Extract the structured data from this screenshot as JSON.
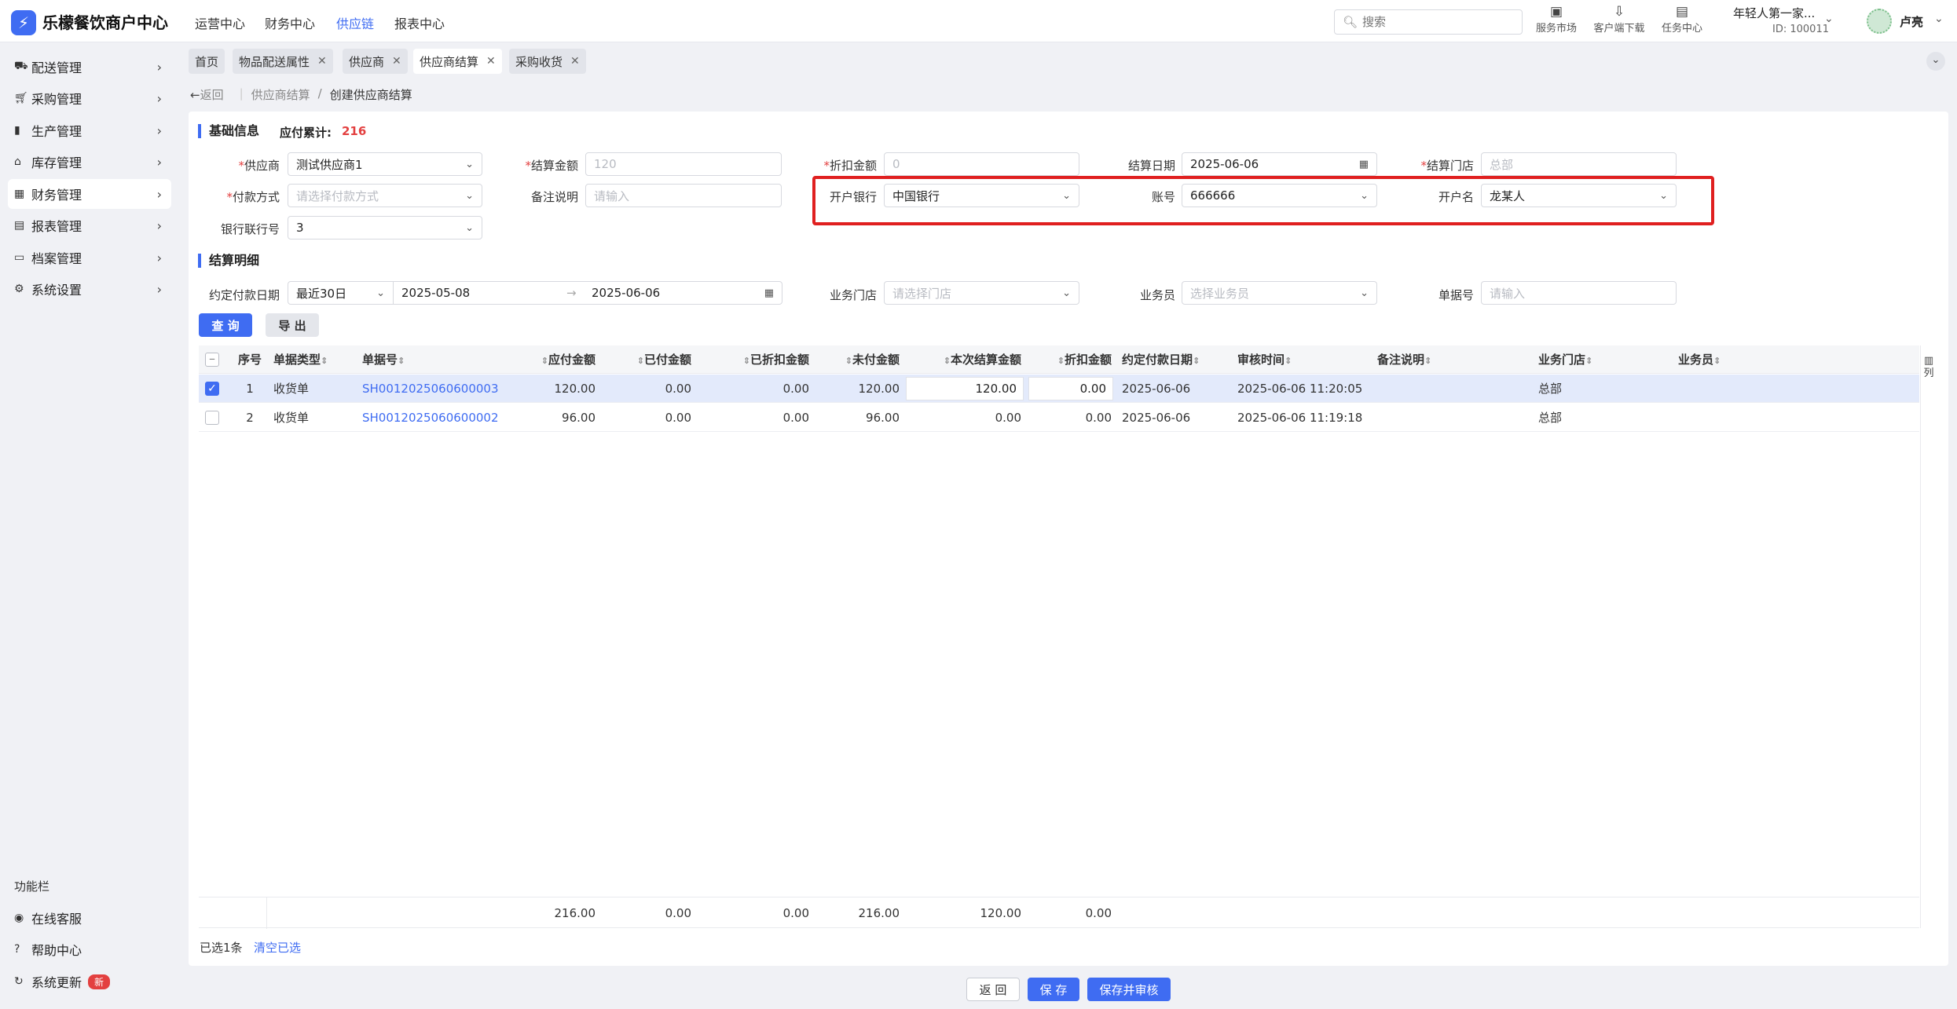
{
  "header": {
    "brand": "乐檬餐饮商户中心",
    "nav": [
      "运营中心",
      "财务中心",
      "供应链",
      "报表中心"
    ],
    "active_nav": "供应链",
    "search_placeholder": "搜索",
    "tools": [
      {
        "icon": "store-icon",
        "label": "服务市场"
      },
      {
        "icon": "download-icon",
        "label": "客户端下载"
      },
      {
        "icon": "task-icon",
        "label": "任务中心"
      }
    ],
    "org_name": "年轻人第一家...",
    "org_id": "ID: 100011",
    "user_name": "卢亮"
  },
  "sidebar": {
    "items": [
      {
        "icon": "truck-icon",
        "label": "配送管理"
      },
      {
        "icon": "cart-icon",
        "label": "采购管理"
      },
      {
        "icon": "chart-icon",
        "label": "生产管理"
      },
      {
        "icon": "warehouse-icon",
        "label": "库存管理"
      },
      {
        "icon": "ledger-icon",
        "label": "财务管理"
      },
      {
        "icon": "report-icon",
        "label": "报表管理"
      },
      {
        "icon": "archive-icon",
        "label": "档案管理"
      },
      {
        "icon": "gear-icon",
        "label": "系统设置"
      }
    ],
    "active_item": "财务管理",
    "footer_title": "功能栏",
    "footer_items": [
      {
        "icon": "headset-icon",
        "label": "在线客服"
      },
      {
        "icon": "help-icon",
        "label": "帮助中心"
      },
      {
        "icon": "refresh-icon",
        "label": "系统更新",
        "badge": "新"
      }
    ]
  },
  "tabs": [
    {
      "label": "首页",
      "closable": false
    },
    {
      "label": "物品配送属性",
      "closable": true
    },
    {
      "label": "供应商",
      "closable": true
    },
    {
      "label": "供应商结算",
      "closable": true,
      "active": true
    },
    {
      "label": "采购收货",
      "closable": true
    }
  ],
  "breadcrumb": {
    "back": "返回",
    "parent": "供应商结算",
    "sep": "/",
    "current": "创建供应商结算"
  },
  "basic": {
    "title": "基础信息",
    "payable_label": "应付累计:",
    "payable_value": "216",
    "fields": {
      "supplier": {
        "label": "供应商",
        "value": "测试供应商1"
      },
      "settle_amount": {
        "label": "结算金额",
        "placeholder": "120"
      },
      "discount_amount": {
        "label": "折扣金额",
        "placeholder": "0"
      },
      "settle_date": {
        "label": "结算日期",
        "value": "2025-06-06"
      },
      "settle_store": {
        "label": "结算门店",
        "placeholder": "总部"
      },
      "pay_method": {
        "label": "付款方式",
        "placeholder": "请选择付款方式"
      },
      "remark": {
        "label": "备注说明",
        "placeholder": "请输入"
      },
      "bank": {
        "label": "开户银行",
        "value": "中国银行"
      },
      "account": {
        "label": "账号",
        "value": "666666"
      },
      "account_name": {
        "label": "开户名",
        "value": "龙某人"
      },
      "bank_code": {
        "label": "银行联行号",
        "value": "3"
      }
    }
  },
  "detail": {
    "title": "结算明细",
    "filters": {
      "date_label": "约定付款日期",
      "range_preset": "最近30日",
      "start": "2025-05-08",
      "arrow": "→",
      "end": "2025-06-06",
      "store_label": "业务门店",
      "store_placeholder": "请选择门店",
      "staff_label": "业务员",
      "staff_placeholder": "选择业务员",
      "docno_label": "单据号",
      "docno_placeholder": "请输入"
    },
    "query_label": "查 询",
    "export_label": "导 出",
    "columns": [
      "序号",
      "单据类型",
      "单据号",
      "应付金额",
      "已付金额",
      "已折扣金额",
      "未付金额",
      "本次结算金额",
      "折扣金额",
      "约定付款日期",
      "审核时间",
      "备注说明",
      "业务门店",
      "业务员"
    ],
    "col_setting": "列",
    "rows": [
      {
        "checked": true,
        "idx": "1",
        "type": "收货单",
        "no": "SH0012025060600003",
        "payable": "120.00",
        "paid": "0.00",
        "discounted": "0.00",
        "unpaid": "120.00",
        "settle": "120.00",
        "discount": "0.00",
        "due": "2025-06-06",
        "audit": "2025-06-06 11:20:05",
        "remark": "",
        "store": "总部",
        "staff": ""
      },
      {
        "checked": false,
        "idx": "2",
        "type": "收货单",
        "no": "SH0012025060600002",
        "payable": "96.00",
        "paid": "0.00",
        "discounted": "0.00",
        "unpaid": "96.00",
        "settle": "0.00",
        "discount": "0.00",
        "due": "2025-06-06",
        "audit": "2025-06-06 11:19:18",
        "remark": "",
        "store": "总部",
        "staff": ""
      }
    ],
    "totals": {
      "payable": "216.00",
      "paid": "0.00",
      "discounted": "0.00",
      "unpaid": "216.00",
      "settle": "120.00",
      "discount": "0.00"
    },
    "selected_text": "已选1条",
    "clear_text": "清空已选"
  },
  "footer": {
    "back": "返 回",
    "save": "保 存",
    "save_audit": "保存并审核"
  },
  "colors": {
    "primary": "#3f6cf2",
    "danger": "#e34040",
    "highlight": "#e02020"
  }
}
